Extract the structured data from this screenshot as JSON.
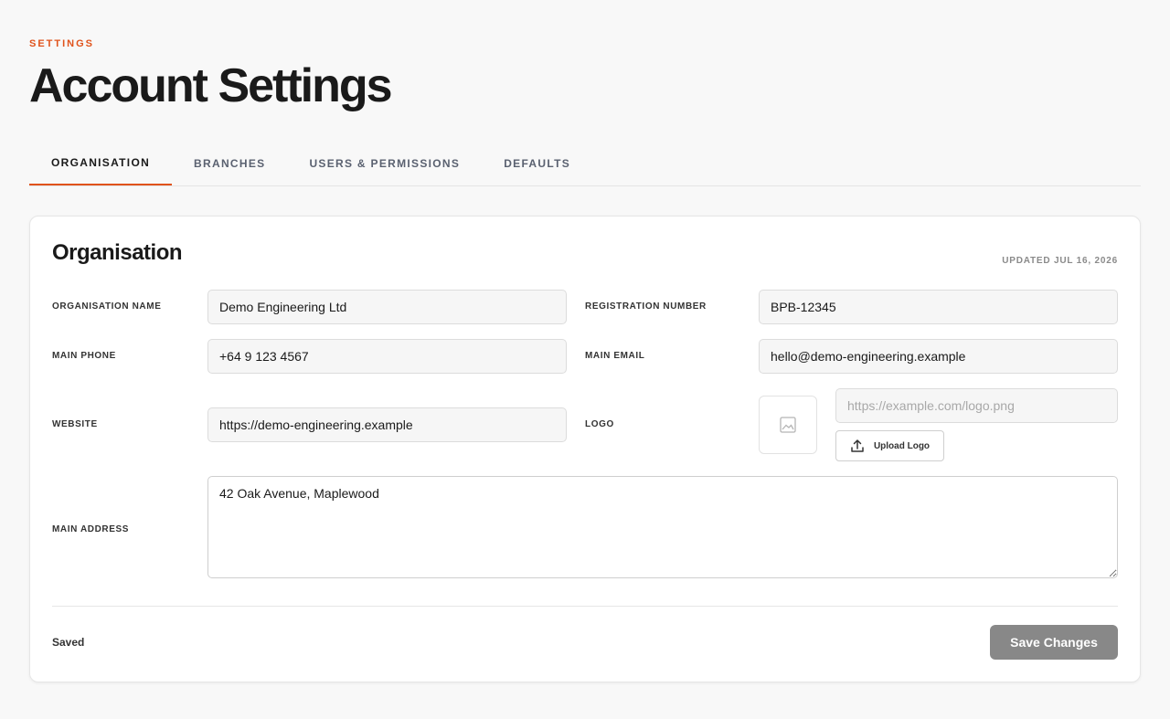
{
  "header": {
    "eyebrow": "SETTINGS",
    "title": "Account Settings"
  },
  "tabs": [
    {
      "label": "ORGANISATION",
      "active": true
    },
    {
      "label": "BRANCHES",
      "active": false
    },
    {
      "label": "USERS & PERMISSIONS",
      "active": false
    },
    {
      "label": "DEFAULTS",
      "active": false
    }
  ],
  "card": {
    "title": "Organisation",
    "updated": "UPDATED JUL 16, 2026",
    "fields": {
      "organisation_name": {
        "label": "ORGANISATION NAME",
        "value": "Demo Engineering Ltd"
      },
      "registration_number": {
        "label": "REGISTRATION NUMBER",
        "value": "BPB-12345"
      },
      "main_phone": {
        "label": "MAIN PHONE",
        "value": "+64 9 123 4567"
      },
      "main_email": {
        "label": "MAIN EMAIL",
        "value": "hello@demo-engineering.example"
      },
      "website": {
        "label": "WEBSITE",
        "value": "https://demo-engineering.example"
      },
      "logo": {
        "label": "LOGO",
        "value": "",
        "placeholder": "https://example.com/logo.png",
        "upload_label": "Upload Logo"
      },
      "main_address": {
        "label": "MAIN ADDRESS",
        "value": "42 Oak Avenue, Maplewood"
      }
    },
    "status": "Saved",
    "save_label": "Save Changes"
  },
  "colors": {
    "accent": "#e0531c",
    "save_button": "#888888"
  }
}
